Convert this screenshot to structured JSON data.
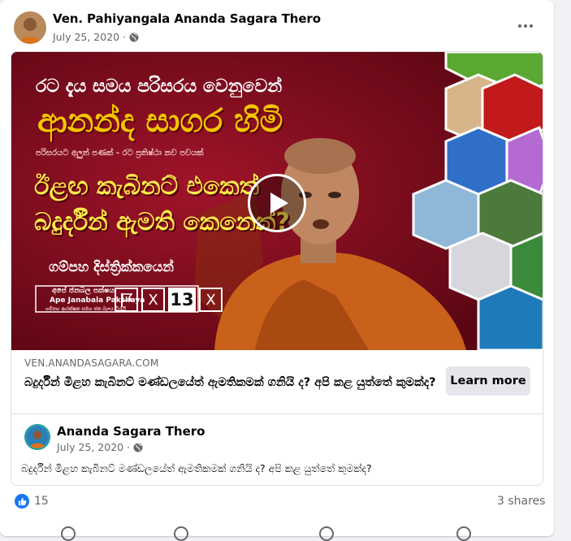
{
  "post": {
    "author": "Ven. Pahiyangala Ananda Sagara Thero",
    "date": "July 25, 2020",
    "privacy_icon": "globe-icon",
    "more_icon": "more-options-icon"
  },
  "shared_link": {
    "thumbnail": {
      "line1": "රට දැය සමය පරිසරය වෙනුවෙන්",
      "line2": "ආනන්ද සාගර හිමි",
      "line3": "පරිසරයට අලුත් පණක් - රට ප්‍රතිෂ්ඨා නව පවයක්",
      "line4": "ඊළඟ කැබිනට් එකෙත්",
      "line5": "බදුර්දීන් ඇමති කෙනෙක්?",
      "line6": "ගම්පහ දිස්ත්‍රික්කයෙන්",
      "party_si": "අපේ ජනබල පක්ෂය",
      "party_en": "Ape Janabala Pakshaya",
      "party_sub": "ගම්පහ ආරක්ෂක සමග ජන බලය ඩිරැයි",
      "ballot_number": "13",
      "ballot_mark": "X",
      "play_icon": "play-icon",
      "colors": {
        "bg": "#7a0b1a",
        "title_yellow": "#f5c400",
        "robe": "#c9611b"
      }
    },
    "domain": "VEN.ANANDASAGARA.COM",
    "title": "බදුර්දීන් මිළහ කැබිනට් මණ්ඩලයේත් ඇමතිකමක් ගනියි ද? අපි කළ යුත්තේ කුමක්ද?",
    "cta_label": "Learn more"
  },
  "quoted_post": {
    "author": "Ananda Sagara Thero",
    "date": "July 25, 2020",
    "text": "බදුර්දීන් මිළහ කැබිනට් මණ්ඩලයේත් ඇමතිකමක්  ගනියි ද? අපි කළ යුත්තේ කුමක්ද?"
  },
  "footer": {
    "reaction_icon": "like-icon",
    "reaction_count": "15",
    "shares": "3 shares"
  }
}
